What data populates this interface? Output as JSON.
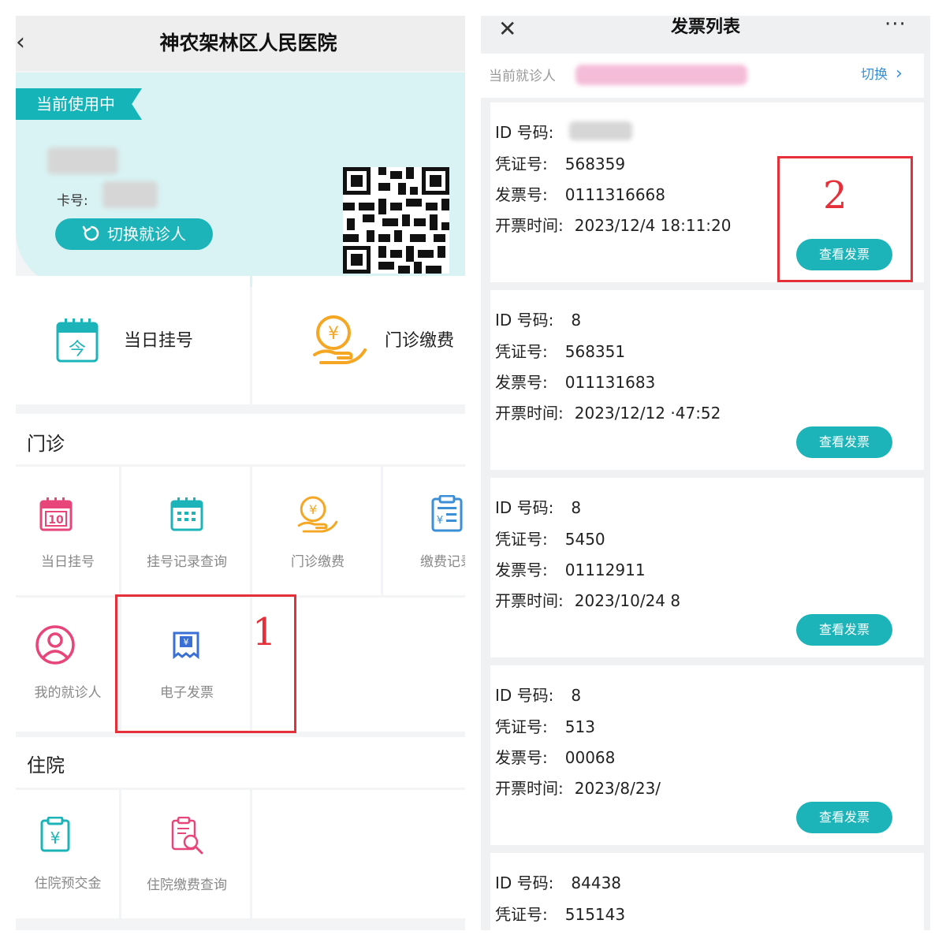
{
  "left": {
    "header": {
      "back_icon": "chevron-left-icon",
      "back_glyph": "‹",
      "title": "神农架林区人民医院"
    },
    "card": {
      "tag": "当前使用中",
      "card_no_label": "卡号:",
      "switch_label": "切换就诊人",
      "switch_icon": "refresh-icon",
      "qr_icon": "qr-code-icon"
    },
    "quick": [
      {
        "label": "当日挂号",
        "icon": "calendar-today-icon",
        "icon_text": "今",
        "color": "#1cb4b8"
      },
      {
        "label": "门诊缴费",
        "icon": "hand-coin-icon",
        "icon_text": "¥",
        "color": "#f5a623"
      }
    ],
    "outpatient": {
      "title": "门诊",
      "items": [
        {
          "label": "当日挂号",
          "icon": "calendar-10-icon",
          "icon_text": "10",
          "color": "#e8457a"
        },
        {
          "label": "挂号记录查询",
          "icon": "calendar-grid-icon",
          "color": "#1cb4b8"
        },
        {
          "label": "门诊缴费",
          "icon": "hand-coin-icon",
          "icon_text": "¥",
          "color": "#f5a623"
        },
        {
          "label": "缴费记录",
          "icon": "receipt-list-icon",
          "icon_text": "¥",
          "color": "#3a8fd6"
        },
        {
          "label": "我的就诊人",
          "icon": "user-circle-icon",
          "color": "#e8457a"
        },
        {
          "label": "电子发票",
          "icon": "e-invoice-icon",
          "icon_text": "¥",
          "color": "#3a6fd6"
        }
      ]
    },
    "inpatient": {
      "title": "住院",
      "items": [
        {
          "label": "住院预交金",
          "icon": "deposit-clipboard-icon",
          "icon_text": "¥",
          "color": "#1cb4b8"
        },
        {
          "label": "住院缴费查询",
          "icon": "bill-search-icon",
          "color": "#e8457a"
        }
      ]
    },
    "annotation": {
      "number": "1",
      "color": "#e5303a"
    }
  },
  "right": {
    "header": {
      "close_glyph": "✕",
      "close_icon": "close-icon",
      "title": "发票列表",
      "more_glyph": "···",
      "more_icon": "more-icon"
    },
    "patient": {
      "label": "当前就诊人",
      "switch": "切换",
      "chevron": "›"
    },
    "labels": {
      "id": "ID 号码:",
      "voucher": "凭证号:",
      "invoice": "发票号:",
      "time": "开票时间:",
      "view": "查看发票"
    },
    "invoices": [
      {
        "id": "",
        "voucher": "568359",
        "invoice": "0111316668",
        "time": "2023/12/4 18:11:20"
      },
      {
        "id": "8",
        "voucher": "568351",
        "invoice": "011131683",
        "time": "2023/12/12 ·47:52"
      },
      {
        "id": "8",
        "voucher": "5450",
        "invoice": "01112911",
        "time": "2023/10/24  8"
      },
      {
        "id": "8",
        "voucher": "513",
        "invoice": "00068",
        "time": "2023/8/23/"
      },
      {
        "id": "84438",
        "voucher": "515143"
      }
    ],
    "annotation": {
      "number": "2",
      "color": "#e5303a"
    }
  }
}
